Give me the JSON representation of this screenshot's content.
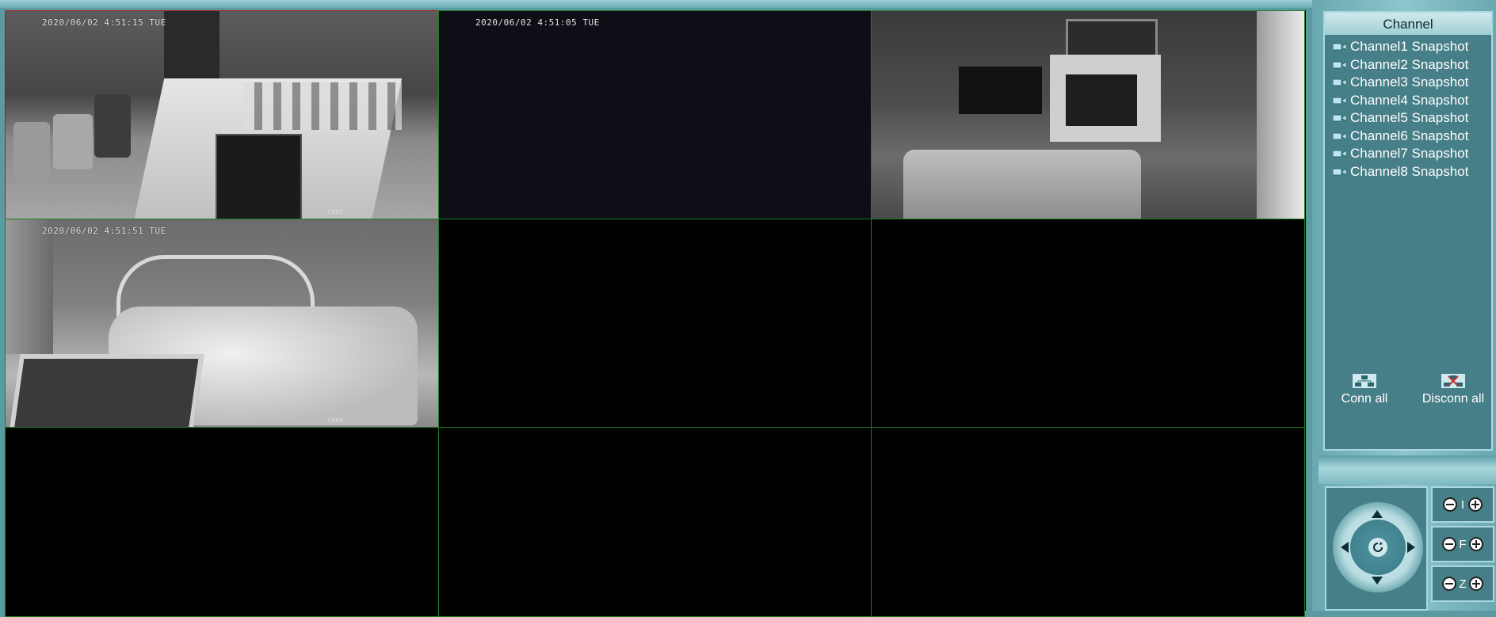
{
  "cameras": [
    {
      "id": "cell-1",
      "timestamp": "2020/06/02 4:51:15 TUE",
      "label": "CH01",
      "scene": "kitchen"
    },
    {
      "id": "cell-2",
      "timestamp": "2020/06/02 4:51:05 TUE",
      "label": "",
      "scene": "dark"
    },
    {
      "id": "cell-3",
      "timestamp": "",
      "label": "",
      "scene": "living"
    },
    {
      "id": "cell-4",
      "timestamp": "2020/06/02 4:51:51 TUE",
      "label": "CH04",
      "scene": "bedroom"
    }
  ],
  "channel_panel": {
    "title": "Channel",
    "channels": [
      "Channel1 Snapshot",
      "Channel2 Snapshot",
      "Channel3 Snapshot",
      "Channel4 Snapshot",
      "Channel5 Snapshot",
      "Channel6 Snapshot",
      "Channel7 Snapshot",
      "Channel8 Snapshot"
    ],
    "conn_all": "Conn all",
    "disconn_all": "Disconn all"
  },
  "lens": {
    "iris": "I",
    "focus": "F",
    "zoom": "Z"
  },
  "colors": {
    "grid_border": "#1f7d1f",
    "active_border": "#b01818",
    "panel_bg": "#477f88"
  }
}
